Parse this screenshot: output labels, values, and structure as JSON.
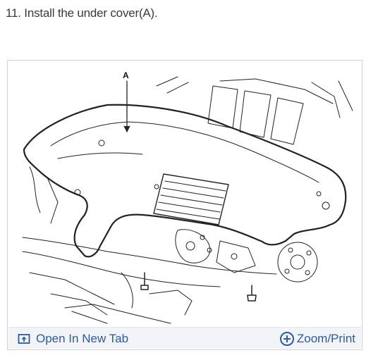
{
  "step": {
    "text": "11. Install the under cover(A)."
  },
  "figure": {
    "callout": "A"
  },
  "toolbar": {
    "open_label": "Open In New Tab",
    "zoom_label": "Zoom/Print",
    "open_icon": "open-new-tab-icon",
    "zoom_icon": "zoom-plus-circle-icon",
    "link_color": "#2b5aa6"
  }
}
